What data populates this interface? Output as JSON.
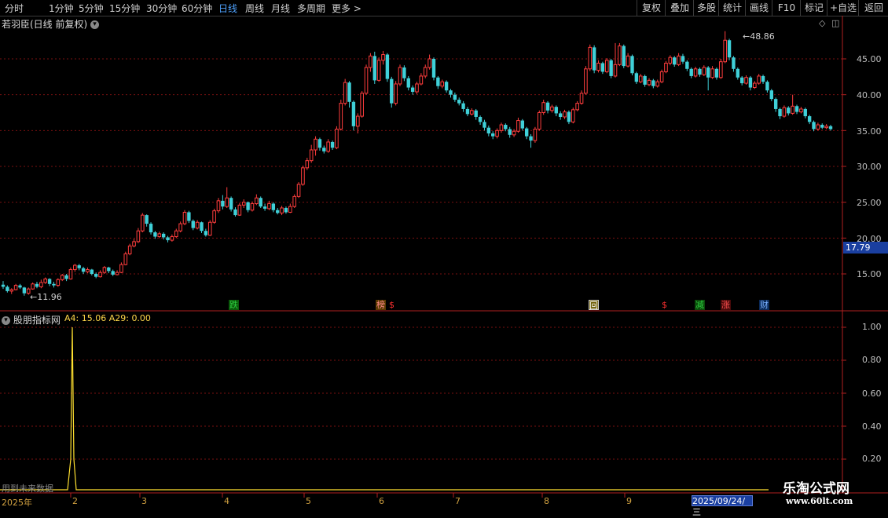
{
  "toolbar": {
    "periods": [
      "分时",
      "1分钟",
      "5分钟",
      "15分钟",
      "30分钟",
      "60分钟",
      "日线",
      "周线",
      "月线",
      "多周期",
      "更多 >"
    ],
    "active_period": "日线",
    "right_buttons": [
      "复权",
      "叠加",
      "多股",
      "统计",
      "画线",
      "F10",
      "标记",
      "+自选",
      "返回"
    ]
  },
  "main_panel": {
    "title": "若羽臣(日线 前复权)",
    "high_marker": "48.86",
    "low_marker": "11.96",
    "current_price": "17.79",
    "price_ticks": [
      "45.00",
      "40.00",
      "35.00",
      "30.00",
      "25.00",
      "20.00",
      "15.00"
    ],
    "events": [
      {
        "label": "跌",
        "color": "#2ecc40",
        "bg": "#0a5a0a"
      },
      {
        "label": "榜",
        "color": "#ff8a8a",
        "bg": "#5a3a00"
      },
      {
        "label": "$",
        "color": "#ff3030",
        "bg": ""
      },
      {
        "label": "回",
        "color": "#ffffff",
        "bg": "#6a5a00"
      },
      {
        "label": "$",
        "color": "#ff3030",
        "bg": ""
      },
      {
        "label": "减",
        "color": "#2ecc40",
        "bg": "#0a4a0a"
      },
      {
        "label": "涨",
        "color": "#ff5050",
        "bg": "#4a0a0a"
      },
      {
        "label": "财",
        "color": "#7ab0ff",
        "bg": "#0a2a5a"
      }
    ]
  },
  "indicator_panel": {
    "title": "股朋指标网",
    "values": "A4: 15.06  A29: 0.00",
    "ticks": [
      "1.00",
      "0.80",
      "0.60",
      "0.40",
      "0.20"
    ],
    "note": "用到未来数据"
  },
  "time_axis": {
    "labels": [
      "2025年",
      "2",
      "3",
      "4",
      "5",
      "6",
      "7",
      "8",
      "9"
    ],
    "current_date": "2025/09/24/三"
  },
  "watermark": {
    "line1": "乐淘公式网",
    "line2": "www.60lt.com"
  },
  "chart_data": {
    "type": "candlestick",
    "ylim": [
      10,
      50
    ],
    "candles": [
      [
        13.5,
        13.2,
        14.0,
        12.9
      ],
      [
        13.2,
        12.6,
        13.4,
        12.4
      ],
      [
        12.6,
        12.8,
        13.0,
        12.2
      ],
      [
        12.8,
        13.4,
        13.6,
        12.7
      ],
      [
        13.4,
        13.1,
        13.6,
        12.9
      ],
      [
        13.1,
        12.3,
        13.2,
        11.96
      ],
      [
        12.3,
        12.9,
        13.1,
        12.1
      ],
      [
        12.9,
        13.6,
        13.8,
        12.8
      ],
      [
        13.6,
        13.2,
        13.9,
        13.0
      ],
      [
        13.2,
        13.8,
        14.2,
        13.0
      ],
      [
        13.8,
        14.3,
        14.5,
        13.6
      ],
      [
        14.3,
        13.6,
        14.4,
        13.3
      ],
      [
        13.6,
        13.4,
        13.9,
        13.1
      ],
      [
        13.4,
        14.2,
        14.4,
        13.2
      ],
      [
        14.2,
        14.8,
        15.0,
        14.0
      ],
      [
        14.8,
        14.3,
        15.0,
        14.0
      ],
      [
        14.3,
        15.6,
        15.9,
        14.2
      ],
      [
        15.6,
        16.2,
        16.4,
        15.3
      ],
      [
        16.2,
        15.8,
        16.4,
        15.5
      ],
      [
        15.8,
        15.3,
        16.0,
        15.0
      ],
      [
        15.3,
        15.6,
        15.9,
        15.1
      ],
      [
        15.6,
        15.0,
        15.7,
        14.8
      ],
      [
        15.0,
        14.6,
        15.2,
        14.4
      ],
      [
        14.6,
        15.2,
        15.5,
        14.5
      ],
      [
        15.2,
        15.9,
        16.1,
        15.0
      ],
      [
        15.9,
        15.4,
        16.0,
        15.1
      ],
      [
        15.4,
        14.9,
        15.6,
        14.7
      ],
      [
        14.9,
        15.2,
        15.5,
        14.8
      ],
      [
        15.2,
        16.3,
        16.6,
        15.1
      ],
      [
        16.3,
        17.8,
        18.1,
        16.2
      ],
      [
        17.8,
        18.9,
        19.2,
        17.6
      ],
      [
        18.9,
        19.5,
        19.9,
        18.7
      ],
      [
        19.5,
        21.0,
        21.4,
        19.3
      ],
      [
        21.0,
        23.2,
        23.5,
        20.8
      ],
      [
        23.2,
        22.0,
        23.3,
        21.6
      ],
      [
        22.0,
        20.8,
        22.2,
        20.5
      ],
      [
        20.8,
        20.2,
        21.0,
        19.9
      ],
      [
        20.2,
        20.6,
        20.9,
        20.0
      ],
      [
        20.6,
        20.1,
        20.8,
        19.8
      ],
      [
        20.1,
        19.7,
        20.3,
        19.4
      ],
      [
        19.7,
        20.2,
        20.5,
        19.5
      ],
      [
        20.2,
        21.0,
        21.3,
        20.0
      ],
      [
        21.0,
        22.0,
        22.3,
        20.8
      ],
      [
        22.0,
        23.6,
        23.9,
        21.8
      ],
      [
        23.6,
        22.4,
        23.8,
        22.1
      ],
      [
        22.4,
        21.4,
        22.6,
        21.1
      ],
      [
        21.4,
        22.2,
        22.5,
        21.2
      ],
      [
        22.2,
        21.0,
        22.3,
        20.7
      ],
      [
        21.0,
        20.4,
        21.3,
        20.2
      ],
      [
        20.4,
        22.2,
        22.5,
        20.3
      ],
      [
        22.2,
        23.8,
        24.1,
        22.0
      ],
      [
        23.8,
        25.2,
        25.6,
        23.5
      ],
      [
        25.2,
        24.4,
        26.0,
        24.0
      ],
      [
        24.4,
        25.6,
        27.1,
        24.2
      ],
      [
        25.6,
        24.0,
        25.8,
        23.7
      ],
      [
        24.0,
        23.2,
        24.3,
        23.0
      ],
      [
        23.2,
        24.6,
        24.9,
        23.1
      ],
      [
        24.6,
        25.0,
        25.4,
        24.2
      ],
      [
        25.0,
        23.9,
        25.1,
        23.6
      ],
      [
        23.9,
        24.8,
        25.1,
        23.7
      ],
      [
        24.8,
        25.6,
        26.1,
        24.6
      ],
      [
        25.6,
        24.4,
        25.8,
        24.2
      ],
      [
        24.4,
        24.1,
        24.8,
        23.8
      ],
      [
        24.1,
        24.8,
        25.2,
        23.9
      ],
      [
        24.8,
        23.9,
        25.0,
        23.6
      ],
      [
        23.9,
        23.5,
        24.2,
        23.3
      ],
      [
        23.5,
        24.2,
        24.5,
        23.2
      ],
      [
        24.2,
        23.6,
        24.4,
        23.4
      ],
      [
        23.6,
        24.4,
        24.8,
        23.5
      ],
      [
        24.4,
        25.8,
        26.1,
        24.2
      ],
      [
        25.8,
        27.5,
        27.8,
        25.6
      ],
      [
        27.5,
        29.8,
        30.1,
        27.3
      ],
      [
        29.8,
        30.8,
        31.2,
        29.5
      ],
      [
        30.8,
        32.3,
        33.0,
        30.5
      ],
      [
        32.3,
        33.8,
        34.2,
        31.5
      ],
      [
        33.8,
        32.6,
        34.0,
        32.2
      ],
      [
        32.6,
        32.1,
        32.9,
        31.8
      ],
      [
        32.1,
        33.4,
        33.8,
        31.9
      ],
      [
        33.4,
        32.6,
        33.6,
        32.3
      ],
      [
        32.6,
        35.2,
        35.6,
        32.4
      ],
      [
        35.2,
        38.8,
        39.3,
        35.0
      ],
      [
        38.8,
        41.7,
        42.2,
        38.5
      ],
      [
        41.7,
        39.0,
        41.9,
        38.2
      ],
      [
        39.0,
        35.6,
        39.2,
        35.0
      ],
      [
        35.6,
        37.0,
        37.4,
        34.6
      ],
      [
        37.0,
        40.2,
        40.5,
        36.8
      ],
      [
        40.2,
        43.8,
        44.2,
        40.0
      ],
      [
        43.8,
        45.4,
        45.8,
        43.2
      ],
      [
        45.4,
        42.0,
        46.0,
        41.5
      ],
      [
        42.0,
        44.8,
        45.2,
        41.8
      ],
      [
        44.8,
        45.6,
        46.1,
        44.2
      ],
      [
        45.6,
        42.2,
        45.8,
        41.8
      ],
      [
        42.2,
        38.8,
        42.5,
        38.2
      ],
      [
        38.8,
        41.5,
        41.9,
        38.5
      ],
      [
        41.5,
        43.8,
        44.2,
        41.2
      ],
      [
        43.8,
        42.3,
        44.1,
        41.9
      ],
      [
        42.3,
        41.0,
        42.6,
        40.6
      ],
      [
        41.0,
        40.4,
        41.3,
        40.0
      ],
      [
        40.4,
        41.5,
        41.8,
        40.1
      ],
      [
        41.5,
        42.6,
        43.0,
        41.3
      ],
      [
        42.6,
        43.8,
        44.2,
        42.3
      ],
      [
        43.8,
        45.0,
        45.6,
        43.5
      ],
      [
        45.0,
        42.4,
        45.2,
        42.0
      ],
      [
        42.4,
        41.2,
        42.6,
        40.8
      ],
      [
        41.2,
        41.8,
        42.1,
        40.9
      ],
      [
        41.8,
        40.6,
        42.0,
        40.3
      ],
      [
        40.6,
        40.0,
        40.8,
        39.6
      ],
      [
        40.0,
        39.3,
        40.3,
        39.0
      ],
      [
        39.3,
        38.8,
        39.6,
        38.5
      ],
      [
        38.8,
        38.0,
        39.1,
        37.6
      ],
      [
        38.0,
        37.3,
        38.3,
        37.0
      ],
      [
        37.3,
        37.8,
        38.1,
        37.1
      ],
      [
        37.8,
        36.9,
        38.0,
        36.5
      ],
      [
        36.9,
        36.2,
        37.1,
        35.8
      ],
      [
        36.2,
        35.4,
        36.5,
        35.0
      ],
      [
        35.4,
        34.6,
        35.7,
        34.2
      ],
      [
        34.6,
        34.2,
        34.9,
        33.8
      ],
      [
        34.2,
        35.0,
        35.3,
        33.9
      ],
      [
        35.0,
        35.8,
        36.1,
        34.7
      ],
      [
        35.8,
        35.2,
        36.0,
        34.9
      ],
      [
        35.2,
        34.4,
        35.5,
        34.0
      ],
      [
        34.4,
        34.9,
        35.2,
        34.1
      ],
      [
        34.9,
        36.4,
        36.8,
        34.7
      ],
      [
        36.4,
        35.3,
        36.6,
        35.0
      ],
      [
        35.3,
        34.2,
        35.5,
        33.8
      ],
      [
        34.2,
        33.6,
        34.5,
        32.6
      ],
      [
        33.6,
        35.2,
        35.5,
        33.3
      ],
      [
        35.2,
        37.5,
        37.8,
        35.0
      ],
      [
        37.5,
        38.9,
        39.3,
        37.2
      ],
      [
        38.9,
        37.8,
        39.1,
        37.4
      ],
      [
        37.8,
        38.3,
        38.6,
        37.5
      ],
      [
        38.3,
        37.4,
        38.5,
        37.0
      ],
      [
        37.4,
        36.9,
        37.7,
        36.5
      ],
      [
        36.9,
        37.6,
        37.9,
        36.6
      ],
      [
        37.6,
        36.2,
        37.8,
        35.9
      ],
      [
        36.2,
        37.9,
        38.2,
        36.0
      ],
      [
        37.9,
        38.8,
        39.1,
        37.7
      ],
      [
        38.8,
        40.2,
        40.6,
        38.6
      ],
      [
        40.2,
        43.6,
        44.0,
        40.0
      ],
      [
        43.6,
        46.6,
        47.0,
        43.3
      ],
      [
        46.6,
        43.4,
        46.9,
        43.0
      ],
      [
        43.4,
        44.4,
        44.8,
        43.1
      ],
      [
        44.4,
        43.2,
        44.6,
        42.9
      ],
      [
        43.2,
        44.8,
        45.1,
        43.0
      ],
      [
        44.8,
        42.6,
        45.0,
        42.3
      ],
      [
        42.6,
        44.2,
        47.2,
        42.4
      ],
      [
        44.2,
        46.8,
        47.2,
        44.0
      ],
      [
        46.8,
        44.0,
        47.0,
        43.7
      ],
      [
        44.0,
        45.4,
        45.8,
        43.8
      ],
      [
        45.4,
        43.0,
        45.6,
        42.7
      ],
      [
        43.0,
        41.8,
        43.2,
        41.5
      ],
      [
        41.8,
        42.6,
        42.9,
        41.6
      ],
      [
        42.6,
        41.4,
        42.8,
        41.1
      ],
      [
        41.4,
        42.0,
        42.3,
        41.2
      ],
      [
        42.0,
        41.2,
        42.2,
        40.9
      ],
      [
        41.2,
        41.8,
        42.1,
        41.0
      ],
      [
        41.8,
        43.2,
        43.5,
        41.6
      ],
      [
        43.2,
        44.4,
        44.7,
        43.0
      ],
      [
        44.4,
        45.2,
        45.5,
        44.1
      ],
      [
        45.2,
        44.2,
        45.4,
        43.9
      ],
      [
        44.2,
        45.4,
        45.8,
        44.0
      ],
      [
        45.4,
        44.6,
        45.7,
        44.3
      ],
      [
        44.6,
        43.6,
        44.8,
        43.3
      ],
      [
        43.6,
        42.6,
        43.8,
        42.3
      ],
      [
        42.6,
        43.6,
        43.9,
        42.4
      ],
      [
        43.6,
        42.8,
        43.8,
        42.5
      ],
      [
        42.8,
        43.8,
        44.1,
        42.6
      ],
      [
        43.8,
        42.4,
        44.0,
        40.6
      ],
      [
        42.4,
        43.6,
        44.0,
        42.2
      ],
      [
        43.6,
        42.4,
        43.8,
        42.1
      ],
      [
        42.4,
        44.6,
        45.0,
        42.2
      ],
      [
        44.6,
        47.6,
        48.86,
        44.4
      ],
      [
        47.6,
        45.2,
        47.8,
        44.8
      ],
      [
        45.2,
        43.6,
        45.4,
        43.2
      ],
      [
        43.6,
        42.4,
        43.8,
        42.1
      ],
      [
        42.4,
        41.6,
        42.6,
        41.3
      ],
      [
        41.6,
        42.4,
        42.7,
        41.4
      ],
      [
        42.4,
        41.0,
        42.6,
        40.6
      ],
      [
        41.0,
        41.6,
        41.9,
        40.8
      ],
      [
        41.6,
        42.6,
        42.9,
        41.4
      ],
      [
        42.6,
        41.8,
        42.8,
        41.5
      ],
      [
        41.8,
        40.6,
        42.0,
        40.3
      ],
      [
        40.6,
        39.4,
        40.8,
        39.1
      ],
      [
        39.4,
        38.0,
        39.6,
        37.6
      ],
      [
        38.0,
        37.0,
        38.2,
        36.6
      ],
      [
        37.0,
        38.2,
        38.5,
        36.8
      ],
      [
        38.2,
        37.4,
        38.4,
        37.1
      ],
      [
        37.4,
        38.4,
        40.0,
        37.2
      ],
      [
        38.4,
        37.6,
        38.6,
        37.3
      ],
      [
        37.6,
        38.0,
        38.3,
        37.4
      ],
      [
        38.0,
        37.0,
        38.2,
        36.7
      ],
      [
        37.0,
        36.2,
        37.2,
        35.9
      ],
      [
        36.2,
        35.2,
        36.4,
        34.9
      ],
      [
        35.2,
        35.8,
        36.1,
        35.0
      ],
      [
        35.8,
        35.4,
        36.0,
        35.2
      ],
      [
        35.4,
        35.6,
        35.9,
        35.2
      ],
      [
        35.6,
        35.2,
        35.8,
        35.0
      ]
    ]
  }
}
